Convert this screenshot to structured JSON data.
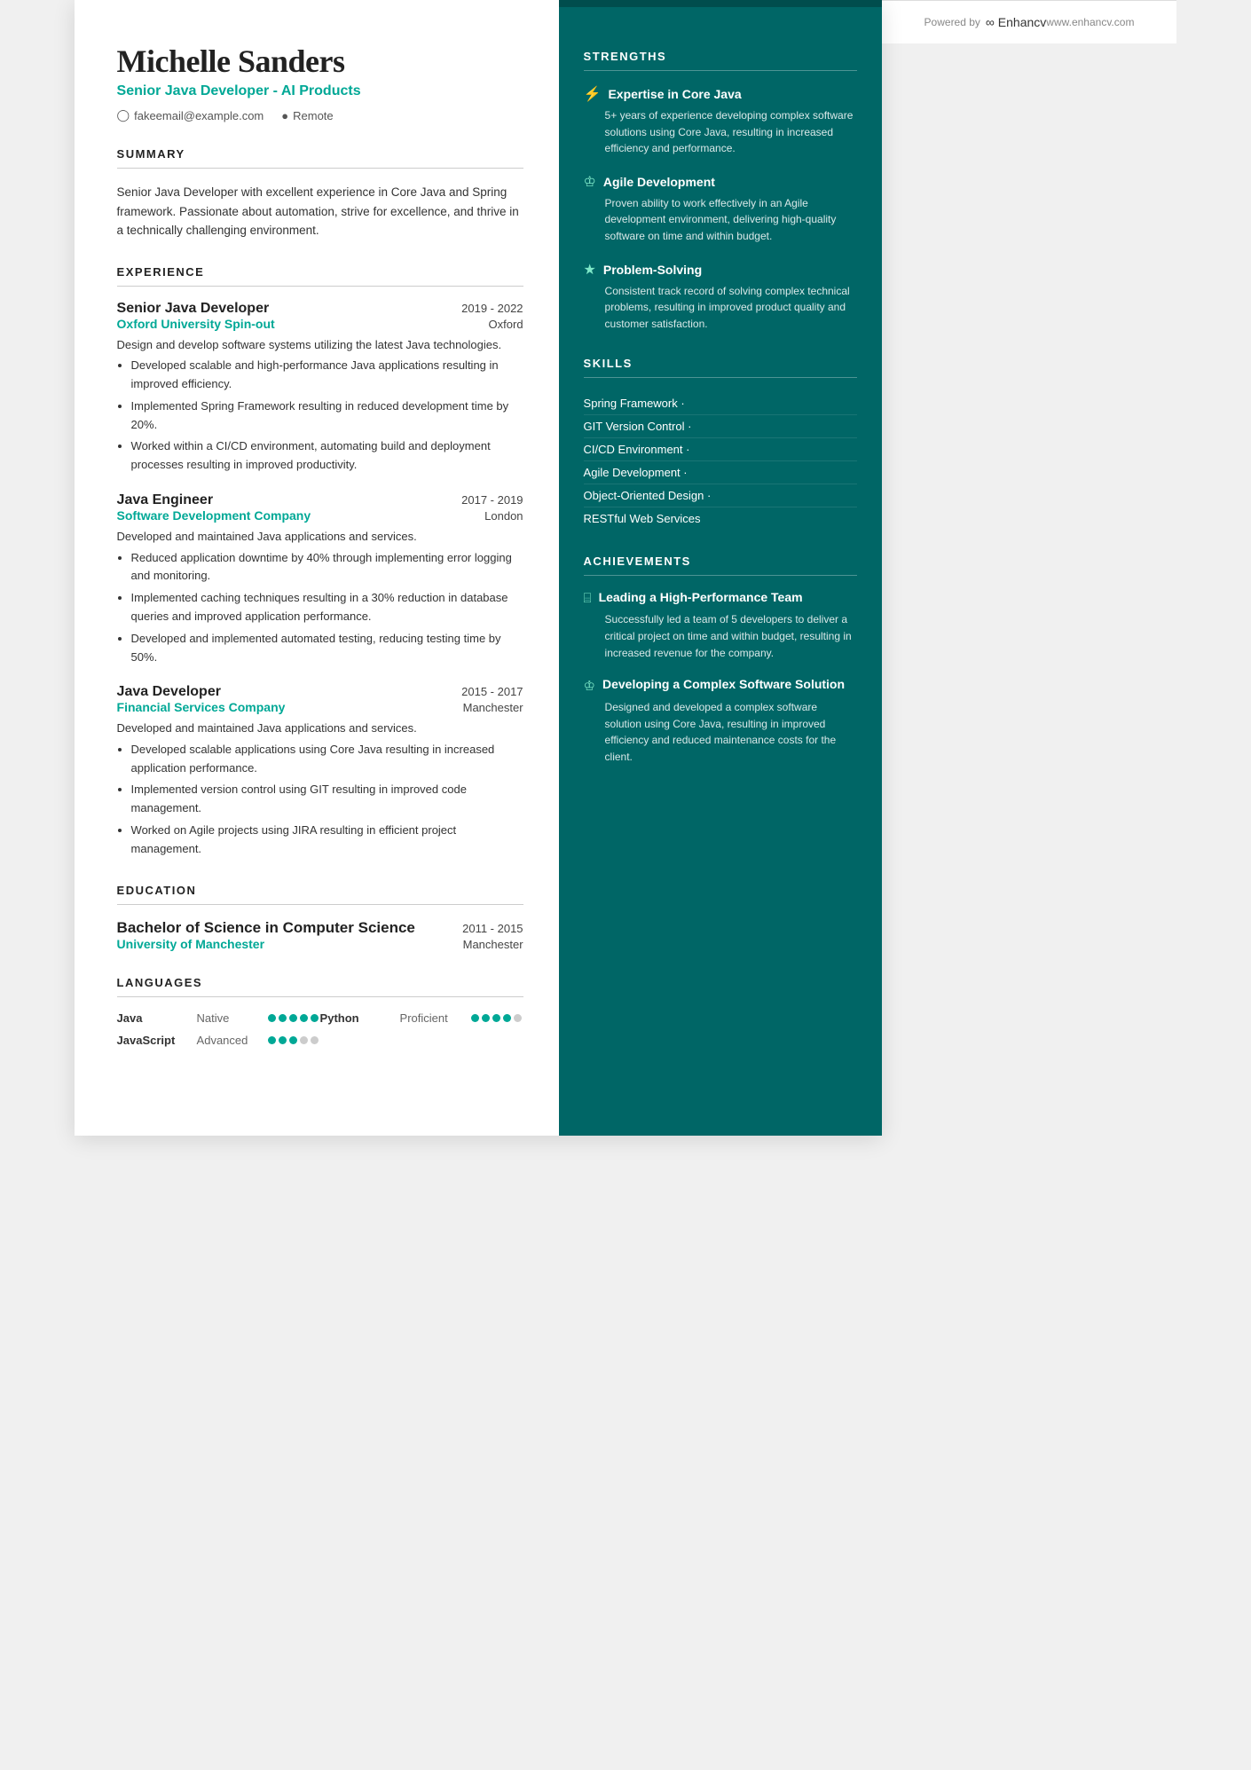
{
  "header": {
    "name": "Michelle Sanders",
    "title": "Senior Java Developer - AI Products",
    "email": "fakeemail@example.com",
    "location": "Remote"
  },
  "summary": {
    "section_title": "SUMMARY",
    "text": "Senior Java Developer with excellent experience in Core Java and Spring framework. Passionate about automation, strive for excellence, and thrive in a technically challenging environment."
  },
  "experience": {
    "section_title": "EXPERIENCE",
    "entries": [
      {
        "role": "Senior Java Developer",
        "dates": "2019 - 2022",
        "company": "Oxford University Spin-out",
        "location": "Oxford",
        "desc": "Design and develop software systems utilizing the latest Java technologies.",
        "bullets": [
          "Developed scalable and high-performance Java applications resulting in improved efficiency.",
          "Implemented Spring Framework resulting in reduced development time by 20%.",
          "Worked within a CI/CD environment, automating build and deployment processes resulting in improved productivity."
        ]
      },
      {
        "role": "Java Engineer",
        "dates": "2017 - 2019",
        "company": "Software Development Company",
        "location": "London",
        "desc": "Developed and maintained Java applications and services.",
        "bullets": [
          "Reduced application downtime by 40% through implementing error logging and monitoring.",
          "Implemented caching techniques resulting in a 30% reduction in database queries and improved application performance.",
          "Developed and implemented automated testing, reducing testing time by 50%."
        ]
      },
      {
        "role": "Java Developer",
        "dates": "2015 - 2017",
        "company": "Financial Services Company",
        "location": "Manchester",
        "desc": "Developed and maintained Java applications and services.",
        "bullets": [
          "Developed scalable applications using Core Java resulting in increased application performance.",
          "Implemented version control using GIT resulting in improved code management.",
          "Worked on Agile projects using JIRA resulting in efficient project management."
        ]
      }
    ]
  },
  "education": {
    "section_title": "EDUCATION",
    "entries": [
      {
        "degree": "Bachelor of Science in Computer Science",
        "dates": "2011 - 2015",
        "school": "University of Manchester",
        "location": "Manchester"
      }
    ]
  },
  "languages": {
    "section_title": "LANGUAGES",
    "entries": [
      {
        "name": "Java",
        "level": "Native",
        "dots": 5,
        "filled": 5
      },
      {
        "name": "Python",
        "level": "Proficient",
        "dots": 5,
        "filled": 4
      },
      {
        "name": "JavaScript",
        "level": "Advanced",
        "dots": 5,
        "filled": 3
      }
    ]
  },
  "strengths": {
    "section_title": "STRENGTHS",
    "items": [
      {
        "icon": "⚡",
        "title": "Expertise in Core Java",
        "desc": "5+ years of experience developing complex software solutions using Core Java, resulting in increased efficiency and performance."
      },
      {
        "icon": "♟",
        "title": "Agile Development",
        "desc": "Proven ability to work effectively in an Agile development environment, delivering high-quality software on time and within budget."
      },
      {
        "icon": "★",
        "title": "Problem-Solving",
        "desc": "Consistent track record of solving complex technical problems, resulting in improved product quality and customer satisfaction."
      }
    ]
  },
  "skills": {
    "section_title": "SKILLS",
    "items": [
      "Spring Framework ·",
      "GIT Version Control ·",
      "CI/CD Environment ·",
      "Agile Development ·",
      "Object-Oriented Design ·",
      "RESTful Web Services"
    ]
  },
  "achievements": {
    "section_title": "ACHIEVEMENTS",
    "items": [
      {
        "icon": "⊏",
        "title": "Leading a High-Performance Team",
        "desc": "Successfully led a team of 5 developers to deliver a critical project on time and within budget, resulting in increased revenue for the company."
      },
      {
        "icon": "♟",
        "title": "Developing a Complex Software Solution",
        "desc": "Designed and developed a complex software solution using Core Java, resulting in improved efficiency and reduced maintenance costs for the client."
      }
    ]
  },
  "footer": {
    "powered_by": "Powered by",
    "brand": "Enhancv",
    "website": "www.enhancv.com"
  }
}
